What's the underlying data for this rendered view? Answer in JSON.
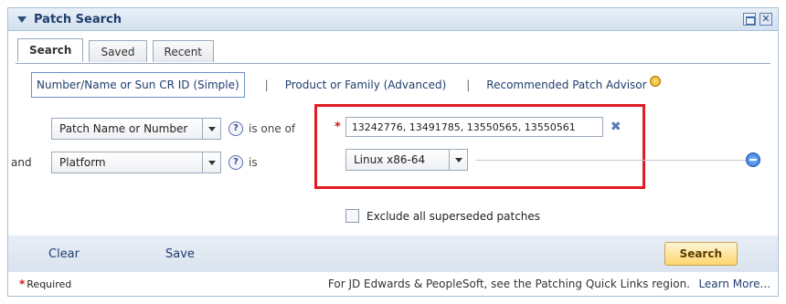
{
  "window": {
    "title": "Patch Search"
  },
  "tabs": [
    {
      "label": "Search",
      "active": true
    },
    {
      "label": "Saved",
      "active": false
    },
    {
      "label": "Recent",
      "active": false
    }
  ],
  "modes": {
    "simple": "Number/Name or Sun CR ID (Simple)",
    "advanced": "Product or Family (Advanced)",
    "advisor": "Recommended Patch Advisor",
    "separator": "|"
  },
  "criteria": [
    {
      "conjunction": "",
      "field": "Patch Name or Number",
      "operator": "is one of",
      "value": "13242776, 13491785, 13550565, 13550561"
    },
    {
      "conjunction": "and",
      "field": "Platform",
      "operator": "is",
      "value": "Linux x86-64"
    }
  ],
  "required_marker": "*",
  "options": {
    "exclude_superseded": "Exclude all superseded patches"
  },
  "actions": {
    "clear": "Clear",
    "save": "Save",
    "search": "Search"
  },
  "footer": {
    "required_label": "Required",
    "info": "For JD Edwards & PeopleSoft, see the Patching Quick Links region.",
    "learn_more": "Learn More..."
  },
  "colors": {
    "highlight_box": "#e01b24",
    "accent": "#1f3e6d",
    "search_button": "#ffd56e"
  }
}
